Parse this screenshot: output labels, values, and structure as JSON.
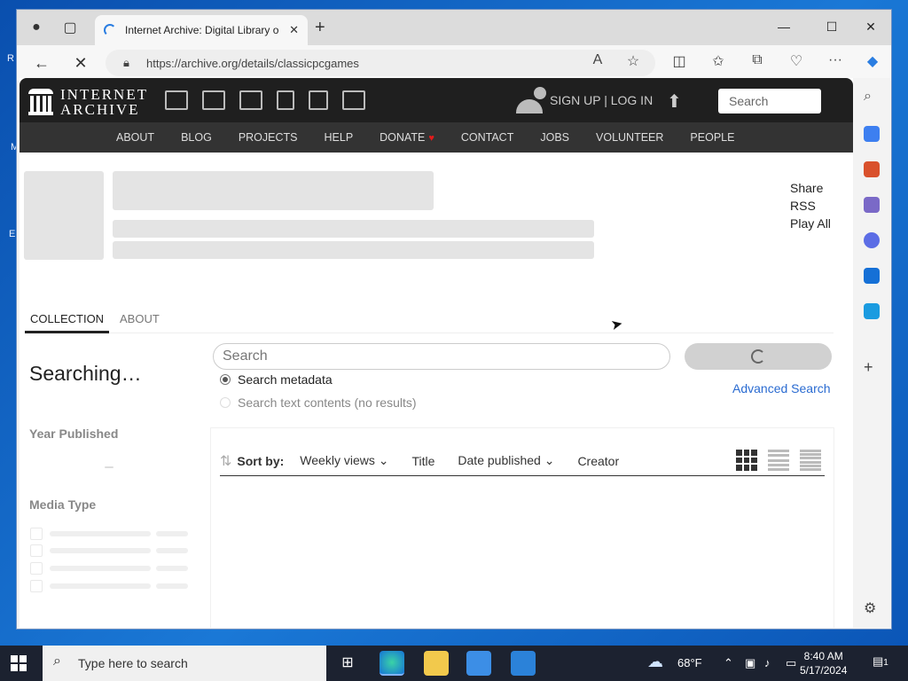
{
  "desktop": {
    "letters": [
      "R",
      "M",
      "E"
    ]
  },
  "browser": {
    "tab_title": "Internet Archive: Digital Library o",
    "tab_close": "✕",
    "new_tab": "+",
    "url": "https://archive.org/details/classicpcgames",
    "controls": {
      "minimize": "—",
      "maximize": "☐",
      "close": "✕"
    }
  },
  "ia": {
    "logo_line1": "INTERNET",
    "logo_line2": "ARCHIVE",
    "signup": "SIGN UP | LOG IN",
    "search_placeholder": "Search",
    "nav": [
      "ABOUT",
      "BLOG",
      "PROJECTS",
      "HELP",
      "DONATE",
      "CONTACT",
      "JOBS",
      "VOLUNTEER",
      "PEOPLE"
    ]
  },
  "collection": {
    "side_links": [
      "Share",
      "RSS",
      "Play All"
    ],
    "tabs": [
      "COLLECTION",
      "ABOUT"
    ],
    "searching": "Searching…",
    "search_placeholder": "Search",
    "radio_metadata": "Search metadata",
    "radio_text": "Search text contents (no results)",
    "advanced_search": "Advanced Search",
    "facets": [
      "Year Published",
      "Media Type"
    ],
    "sort_label": "Sort by:",
    "sort_options": [
      "Weekly views",
      "Title",
      "Date published",
      "Creator"
    ]
  },
  "taskbar": {
    "search_placeholder": "Type here to search",
    "weather": "68°F",
    "time": "8:40 AM",
    "date": "5/17/2024",
    "notification_count": "1"
  }
}
